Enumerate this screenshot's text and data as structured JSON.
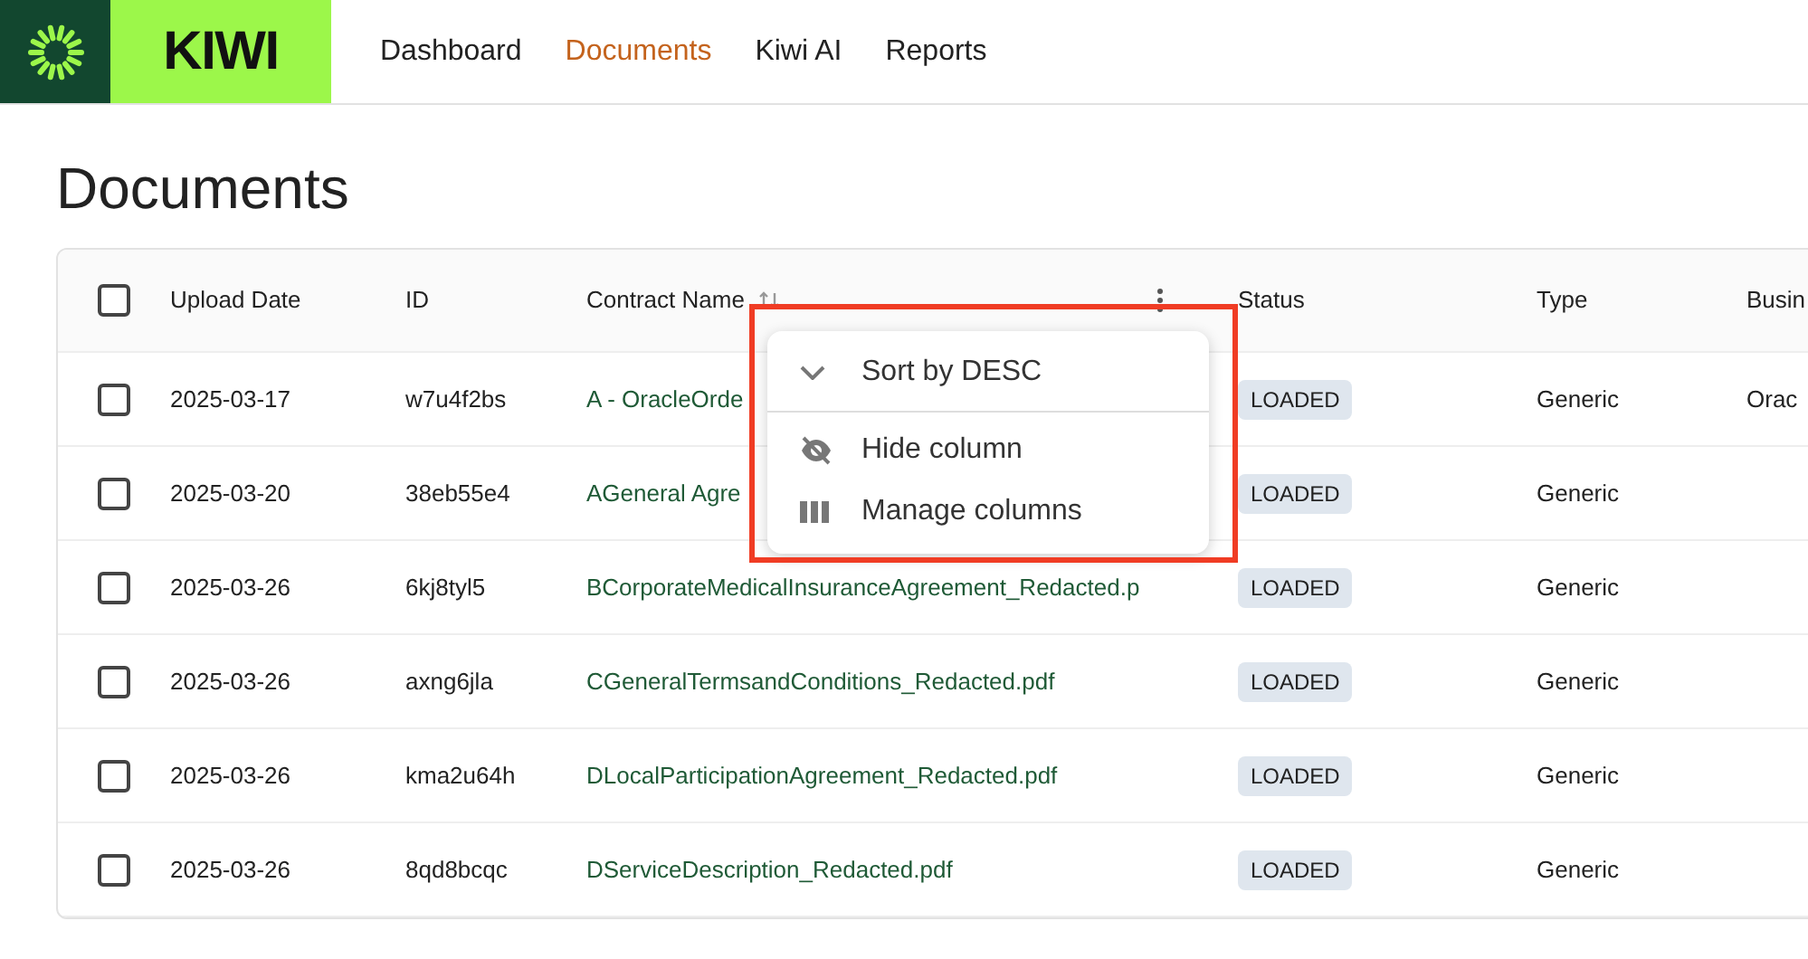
{
  "brand": {
    "name": "KIWI"
  },
  "nav": [
    {
      "label": "Dashboard",
      "selected": false
    },
    {
      "label": "Documents",
      "selected": true
    },
    {
      "label": "Kiwi AI",
      "selected": false
    },
    {
      "label": "Reports",
      "selected": false
    }
  ],
  "page_title": "Documents",
  "table": {
    "select_all_checked": false,
    "columns": [
      "Upload Date",
      "ID",
      "Contract Name",
      "Status",
      "Type",
      "Busin"
    ],
    "rows": [
      {
        "checked": false,
        "cells": [
          "2025-03-17",
          "w7u4f2bs",
          "A - OracleOrde",
          "LOADED",
          "Generic",
          "Orac"
        ]
      },
      {
        "checked": false,
        "cells": [
          "2025-03-20",
          "38eb55e4",
          "AGeneral Agre",
          "LOADED",
          "Generic",
          ""
        ]
      },
      {
        "checked": false,
        "cells": [
          "2025-03-26",
          "6kj8tyl5",
          "BCorporateMedicalInsuranceAgreement_Redacted.p",
          "LOADED",
          "Generic",
          ""
        ]
      },
      {
        "checked": false,
        "cells": [
          "2025-03-26",
          "axng6jla",
          "CGeneralTermsandConditions_Redacted.pdf",
          "LOADED",
          "Generic",
          ""
        ]
      },
      {
        "checked": false,
        "cells": [
          "2025-03-26",
          "kma2u64h",
          "DLocalParticipationAgreement_Redacted.pdf",
          "LOADED",
          "Generic",
          ""
        ]
      },
      {
        "checked": false,
        "cells": [
          "2025-03-26",
          "8qd8bcqc",
          "DServiceDescription_Redacted.pdf",
          "LOADED",
          "Generic",
          ""
        ]
      }
    ]
  },
  "column_menu": {
    "items": [
      {
        "kind": "sort",
        "label": "Sort by DESC"
      },
      {
        "kind": "hide",
        "label": "Hide column"
      },
      {
        "kind": "manage",
        "label": "Manage columns"
      }
    ]
  }
}
